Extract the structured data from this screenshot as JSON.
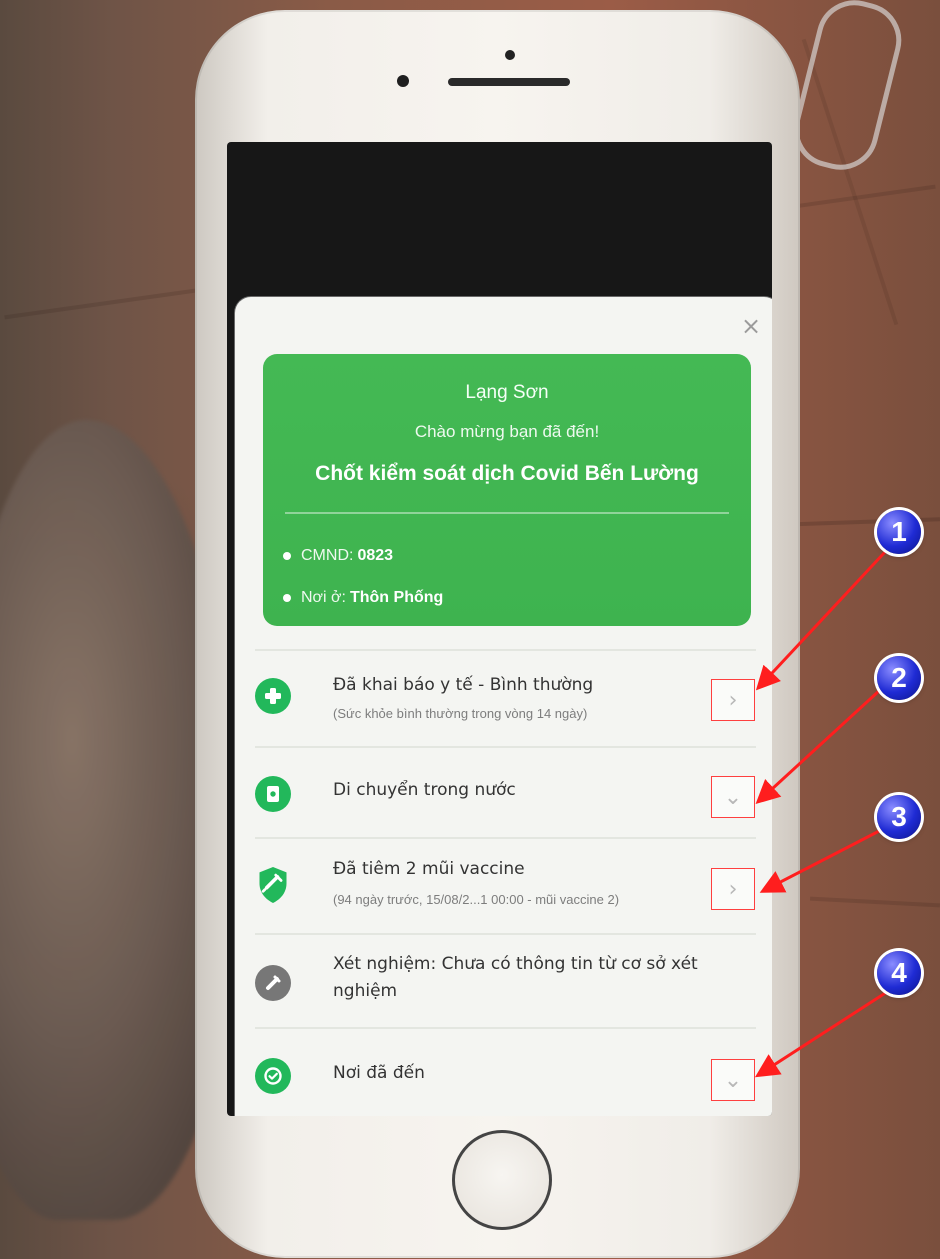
{
  "header": {
    "close_icon": "close-icon",
    "province": "Lạng Sơn",
    "greeting": "Chào mừng bạn đã đến!",
    "checkpoint": "Chốt kiểm soát dịch Covid Bến Lường"
  },
  "identity": {
    "cmnd_label": "CMND:",
    "cmnd_value": "0823",
    "address_label": "Nơi ở:",
    "address_value": "Thôn Phống"
  },
  "list": {
    "items": [
      {
        "title": "Đã khai báo y tế - Bình thường",
        "subtitle": "(Sức khỏe bình thường trong vòng 14 ngày)",
        "icon": "medical-plus-icon",
        "action": "chevron-right"
      },
      {
        "title": "Di chuyển trong nước",
        "subtitle": "",
        "icon": "travel-document-icon",
        "action": "chevron-down"
      },
      {
        "title": "Đã tiêm 2 mũi vaccine",
        "subtitle": "(94 ngày trước, 15/08/2...1 00:00 - mũi vaccine 2)",
        "icon": "vaccine-shield-icon",
        "action": "chevron-right"
      },
      {
        "title_line1": "Xét nghiệm: Chưa có thông tin từ cơ sở xét",
        "title_line2": "nghiệm",
        "icon": "test-tube-icon"
      },
      {
        "title": "Nơi đã đến",
        "subtitle": "",
        "icon": "location-check-icon",
        "action": "chevron-down"
      }
    ]
  },
  "annotations": {
    "one": "1",
    "two": "2",
    "three": "3",
    "four": "4"
  },
  "colors": {
    "green_card": "#41B651",
    "accent_green": "#22B85B",
    "gray_icon": "#777777",
    "annotation_blue": "#1F2BD4",
    "annotation_arrow": "#FF1E1E"
  }
}
